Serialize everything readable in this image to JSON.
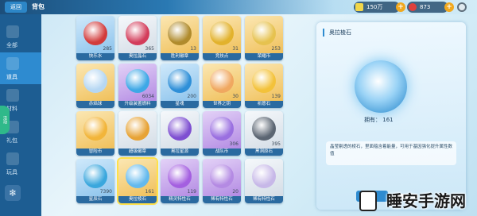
{
  "header": {
    "back_label": "返回",
    "title": "背包",
    "currencies": [
      {
        "icon": "gold-ticket-icon",
        "value": "150万",
        "color": "#f2d74a"
      },
      {
        "icon": "red-gem-icon",
        "value": "873",
        "color": "#e0403c"
      }
    ]
  },
  "sidebar": {
    "items": [
      {
        "label": "全部",
        "active": false
      },
      {
        "label": "道具",
        "active": true
      },
      {
        "label": "材料",
        "active": false
      },
      {
        "label": "礼包",
        "active": false
      },
      {
        "label": "玩具",
        "active": false
      }
    ],
    "green_tab": "活动"
  },
  "grid": {
    "items": [
      {
        "name": "快乐水",
        "count": "285",
        "rarity": "blue",
        "gem_color": "#d23b3b"
      },
      {
        "name": "奥拉晶石",
        "count": "365",
        "rarity": "white",
        "gem_color": "#d33c5a"
      },
      {
        "name": "胜利徽章",
        "count": "13",
        "rarity": "gold",
        "gem_color": "#b08b2c"
      },
      {
        "name": "竞技点",
        "count": "31",
        "rarity": "gold",
        "gem_color": "#e2b22c"
      },
      {
        "name": "荣耀币",
        "count": "253",
        "rarity": "gold",
        "gem_color": "#e6c24f"
      },
      {
        "name": "赤焰球",
        "count": "",
        "rarity": "gold",
        "gem_color": "#b6d7f3"
      },
      {
        "name": "升级装置燃料",
        "count": "6034",
        "rarity": "purple",
        "gem_color": "#3ea8e6"
      },
      {
        "name": "星魂",
        "count": "200",
        "rarity": "blue",
        "gem_color": "#2e8fd8"
      },
      {
        "name": "世界之钥",
        "count": "30",
        "rarity": "gold",
        "gem_color": "#f0a860"
      },
      {
        "name": "祈愿石",
        "count": "139",
        "rarity": "gold",
        "gem_color": "#f3c23a"
      },
      {
        "name": "冒险币",
        "count": "",
        "rarity": "gold",
        "gem_color": "#f2b53a"
      },
      {
        "name": "超级徽章",
        "count": "",
        "rarity": "white",
        "gem_color": "#e7a336"
      },
      {
        "name": "奥拉星源",
        "count": "",
        "rarity": "white",
        "gem_color": "#7e4fd1"
      },
      {
        "name": "战队币",
        "count": "306",
        "rarity": "purple",
        "gem_color": "#9a6fe0"
      },
      {
        "name": "黑洞原石",
        "count": "395",
        "rarity": "white",
        "gem_color": "#5b6572"
      },
      {
        "name": "星辰石",
        "count": "7390",
        "rarity": "blue",
        "gem_color": "#3aa7dd"
      },
      {
        "name": "奥拉棱石",
        "count": "161",
        "rarity": "gold",
        "gem_color": "#63b9ee"
      },
      {
        "name": "精灵特性石",
        "count": "119",
        "rarity": "purple",
        "gem_color": "#a45fe0"
      },
      {
        "name": "稀有特性石",
        "count": "20",
        "rarity": "purple",
        "gem_color": "#b48ae3"
      },
      {
        "name": "稀有特性石",
        "count": "",
        "rarity": "white",
        "gem_color": "#c7b8e8"
      }
    ],
    "selected_index": 16
  },
  "detail": {
    "title": "奥拉棱石",
    "owned_label": "拥有：",
    "owned_value": "161",
    "description": "晶莹剔透的棱石，里面蕴含着能量，可用于基因强化提升属性数值",
    "use_button": "使用"
  },
  "watermark": "睡安手游网"
}
